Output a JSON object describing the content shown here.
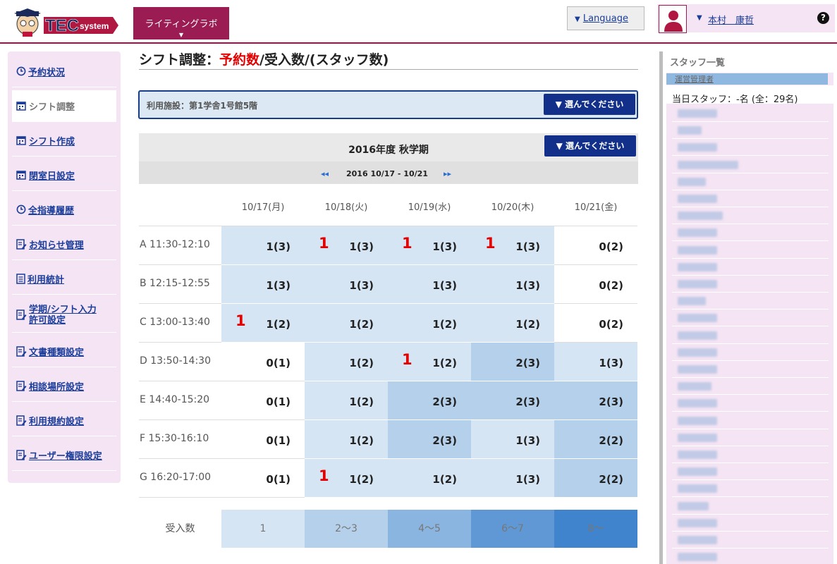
{
  "header": {
    "logo_text": "TEC system",
    "app_button": "ライティングラボ",
    "app_button_caret": "▼",
    "language_arrow": "▼",
    "language": "Language",
    "user_arrow": "▼",
    "user_name": "本村　康哲",
    "help": "?"
  },
  "sidebar": {
    "items": [
      {
        "label": "予約状況",
        "icon": "clock-icon"
      },
      {
        "label": "シフト調整",
        "icon": "calendar-icon",
        "active": true
      },
      {
        "label": "シフト作成",
        "icon": "calendar-icon"
      },
      {
        "label": "閉室日設定",
        "icon": "calendar-icon"
      },
      {
        "label": "全指導履歴",
        "icon": "clock-icon"
      },
      {
        "label": "お知らせ管理",
        "icon": "edit-document-icon"
      },
      {
        "label": "利用統計",
        "icon": "document-icon"
      },
      {
        "label": "学期/シフト入力許可設定",
        "line1": "学期/シフト入力",
        "line2": "許可設定",
        "icon": "edit-document-icon"
      },
      {
        "label": "文書種類設定",
        "icon": "edit-document-icon"
      },
      {
        "label": "相談場所設定",
        "icon": "edit-document-icon"
      },
      {
        "label": "利用規約設定",
        "icon": "edit-document-icon"
      },
      {
        "label": "ユーザー権限設定",
        "icon": "edit-document-icon"
      }
    ]
  },
  "main": {
    "title_prefix": "シフト調整：",
    "title_red": "予約数",
    "title_suffix": "/受入数/(スタッフ数)",
    "facility_label": "利用施設：第1学舎1号館5階",
    "select_label": "▼ 選んでください",
    "term_title": "2016年度 秋学期",
    "term_select_label": "▼ 選んでください",
    "week_range": "2016 10/17 - 10/21",
    "prev_arrow": "◂◂",
    "next_arrow": "▸▸",
    "days": [
      "10/17(月)",
      "10/18(火)",
      "10/19(水)",
      "10/20(木)",
      "10/21(金)"
    ],
    "slots": [
      {
        "label": "A 11:30-12:10",
        "cells": [
          {
            "r": "",
            "v": "1(3)"
          },
          {
            "r": "1",
            "v": "1(3)"
          },
          {
            "r": "1",
            "v": "1(3)"
          },
          {
            "r": "1",
            "v": "1(3)"
          },
          {
            "r": "",
            "v": "0(2)"
          }
        ]
      },
      {
        "label": "B 12:15-12:55",
        "cells": [
          {
            "r": "",
            "v": "1(3)"
          },
          {
            "r": "",
            "v": "1(3)"
          },
          {
            "r": "",
            "v": "1(3)"
          },
          {
            "r": "",
            "v": "1(3)"
          },
          {
            "r": "",
            "v": "0(2)"
          }
        ]
      },
      {
        "label": "C 13:00-13:40",
        "cells": [
          {
            "r": "1",
            "v": "1(2)"
          },
          {
            "r": "",
            "v": "1(2)"
          },
          {
            "r": "",
            "v": "1(2)"
          },
          {
            "r": "",
            "v": "1(2)"
          },
          {
            "r": "",
            "v": "0(2)"
          }
        ]
      },
      {
        "label": "D 13:50-14:30",
        "cells": [
          {
            "r": "",
            "v": "0(1)"
          },
          {
            "r": "",
            "v": "1(2)"
          },
          {
            "r": "1",
            "v": "1(2)"
          },
          {
            "r": "",
            "v": "2(3)"
          },
          {
            "r": "",
            "v": "1(3)"
          }
        ]
      },
      {
        "label": "E 14:40-15:20",
        "cells": [
          {
            "r": "",
            "v": "0(1)"
          },
          {
            "r": "",
            "v": "1(2)"
          },
          {
            "r": "",
            "v": "2(3)"
          },
          {
            "r": "",
            "v": "2(3)"
          },
          {
            "r": "",
            "v": "2(3)"
          }
        ]
      },
      {
        "label": "F 15:30-16:10",
        "cells": [
          {
            "r": "",
            "v": "0(1)"
          },
          {
            "r": "",
            "v": "1(2)"
          },
          {
            "r": "",
            "v": "2(3)"
          },
          {
            "r": "",
            "v": "1(3)"
          },
          {
            "r": "",
            "v": "2(2)"
          }
        ]
      },
      {
        "label": "G 16:20-17:00",
        "cells": [
          {
            "r": "",
            "v": "0(1)"
          },
          {
            "r": "1",
            "v": "1(2)"
          },
          {
            "r": "",
            "v": "1(2)"
          },
          {
            "r": "",
            "v": "1(3)"
          },
          {
            "r": "",
            "v": "2(2)"
          }
        ]
      }
    ],
    "legend_label": "受入数",
    "legend": [
      {
        "label": "1",
        "color": "#d5e5f3"
      },
      {
        "label": "2〜3",
        "color": "#b4d0ea"
      },
      {
        "label": "4〜5",
        "color": "#8ab5e0"
      },
      {
        "label": "6〜7",
        "color": "#5f98d4"
      },
      {
        "label": "8〜",
        "color": "#3f84cc"
      }
    ],
    "cell_colors": {
      "0": "#ffffff",
      "1": "#d5e5f3",
      "2": "#b4d0ea"
    }
  },
  "staff": {
    "title": "スタッフ一覧",
    "role": "運営管理者",
    "count": "当日スタッフ：-名 (全：29名)"
  }
}
